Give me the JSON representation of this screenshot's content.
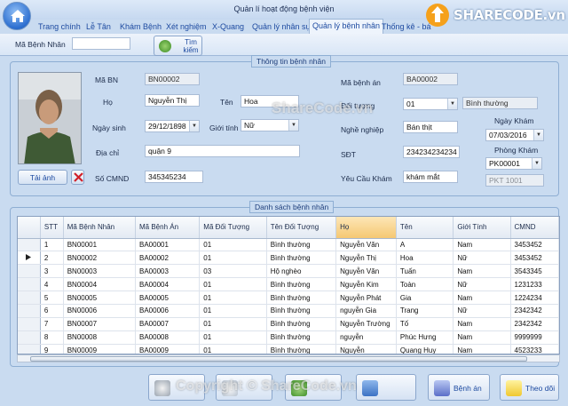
{
  "window": {
    "title": "Quản lí hoạt động bệnh viện"
  },
  "tabs": [
    {
      "label": "Trang chính"
    },
    {
      "label": "Lễ Tân"
    },
    {
      "label": "Khám Bệnh"
    },
    {
      "label": "Xét nghiệm"
    },
    {
      "label": "X-Quang"
    },
    {
      "label": "Quản lý nhân sự"
    },
    {
      "label": "Quản lý bệnh nhân"
    },
    {
      "label": "Thống kê - bá"
    }
  ],
  "logo": {
    "text": "SHARECODE.vn"
  },
  "search": {
    "label": "Mã Bệnh Nhân",
    "value": "",
    "button_label_1": "Tìm",
    "button_label_2": "kiếm"
  },
  "info": {
    "title": "Thông tin bệnh nhân",
    "ma_bn": {
      "label": "Mã BN",
      "value": "BN00002"
    },
    "ho": {
      "label": "Họ",
      "value": "Nguyễn Thị"
    },
    "ten": {
      "label": "Tên",
      "value": "Hoa"
    },
    "ngay_sinh": {
      "label": "Ngày sinh",
      "value": "29/12/1898"
    },
    "gioi_tinh": {
      "label": "Giới tính",
      "value": "Nữ"
    },
    "dia_chi": {
      "label": "Địa chỉ",
      "value": "quận 9"
    },
    "so_cmnd": {
      "label": "Số CMND",
      "value": "345345234"
    },
    "ma_benh_an": {
      "label": "Mã bệnh án",
      "value": "BA00002"
    },
    "doi_tuong": {
      "label": "Đối tượng",
      "value": "01",
      "desc": "Bình thường"
    },
    "nghe_nghiep": {
      "label": "Nghề nghiệp",
      "value": "Bán thịt"
    },
    "sdt": {
      "label": "SĐT",
      "value": "234234234234"
    },
    "yeu_cau_kham": {
      "label": "Yêu Cầu Khám",
      "value": "khám mắt"
    },
    "ngay_kham": {
      "label": "Ngày Khám",
      "value": "07/03/2016"
    },
    "phong_kham": {
      "label": "Phòng Khám",
      "value": "PK00001",
      "desc": "PKT 1001"
    },
    "photo_button": "Tải ảnh"
  },
  "list": {
    "title": "Danh sách bệnh nhân",
    "columns": [
      "STT",
      "Mã Bệnh Nhân",
      "Mã Bệnh Án",
      "Mã Đối Tượng",
      "Tên Đối Tượng",
      "Họ",
      "Tên",
      "Giới Tính",
      "CMND"
    ],
    "rows": [
      [
        "1",
        "BN00001",
        "BA00001",
        "01",
        "Bình thường",
        "Nguyễn Văn",
        "A",
        "Nam",
        "3453452"
      ],
      [
        "2",
        "BN00002",
        "BA00002",
        "01",
        "Bình thường",
        "Nguyễn Thị",
        "Hoa",
        "Nữ",
        "3453452"
      ],
      [
        "3",
        "BN00003",
        "BA00003",
        "03",
        "Hộ nghèo",
        "Nguyễn Văn",
        "Tuấn",
        "Nam",
        "3543345"
      ],
      [
        "4",
        "BN00004",
        "BA00004",
        "01",
        "Bình thường",
        "Nguyễn Kim",
        "Toàn",
        "Nữ",
        "1231233"
      ],
      [
        "5",
        "BN00005",
        "BA00005",
        "01",
        "Bình thường",
        "Nguyễn Phát",
        "Gia",
        "Nam",
        "1224234"
      ],
      [
        "6",
        "BN00006",
        "BA00006",
        "01",
        "Bình thường",
        "nguyễn Gia",
        "Trang",
        "Nữ",
        "2342342"
      ],
      [
        "7",
        "BN00007",
        "BA00007",
        "01",
        "Bình thường",
        "Nguyễn Trường",
        "Tố",
        "Nam",
        "2342342"
      ],
      [
        "8",
        "BN00008",
        "BA00008",
        "01",
        "Bình thường",
        "nguyễn",
        "Phúc Hưng",
        "Nam",
        "9999999"
      ],
      [
        "9",
        "BN00009",
        "BA00009",
        "01",
        "Bình thường",
        "Nguyễn",
        "Quang Huy",
        "Nam",
        "4523233"
      ]
    ],
    "selected_row": 1
  },
  "buttons": {
    "benh_an": "Bệnh án",
    "theo_doi": "Theo dõi"
  },
  "watermarks": {
    "center": "ShareCode.vn",
    "bottom": "Copyright © ShareCode.vn"
  },
  "colors": {
    "header_highlight": "#f5c873",
    "accent": "#1d4aa0"
  }
}
